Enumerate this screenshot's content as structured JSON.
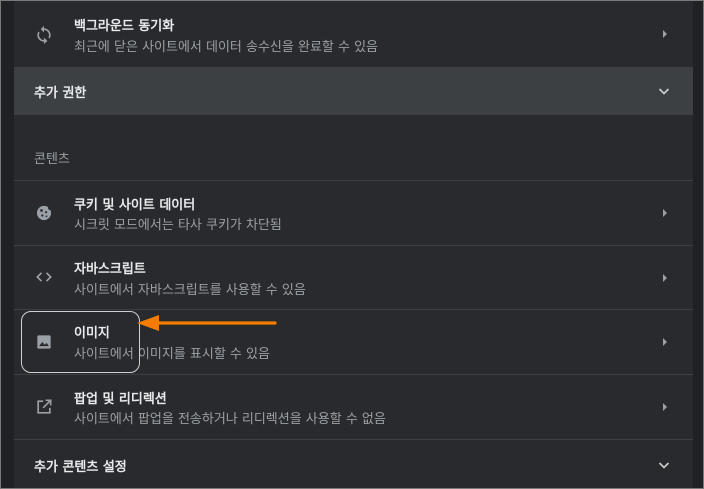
{
  "rows": {
    "background_sync": {
      "title": "백그라운드 동기화",
      "subtitle": "최근에 닫은 사이트에서 데이터 송수신을 완료할 수 있음",
      "icon": "sync-icon"
    },
    "additional_permissions": {
      "label": "추가 권한"
    },
    "content_section": {
      "label": "콘텐츠"
    },
    "cookies": {
      "title": "쿠키 및 사이트 데이터",
      "subtitle": "시크릿 모드에서는 타사 쿠키가 차단됨",
      "icon": "cookie-icon"
    },
    "javascript": {
      "title": "자바스크립트",
      "subtitle": "사이트에서 자바스크립트를 사용할 수 있음",
      "icon": "code-icon"
    },
    "images": {
      "title": "이미지",
      "subtitle": "사이트에서 이미지를 표시할 수 있음",
      "icon": "image-icon"
    },
    "popups": {
      "title": "팝업 및 리디렉션",
      "subtitle": "사이트에서 팝업을 전송하거나 리디렉션을 사용할 수 없음",
      "icon": "open-in-new-icon"
    },
    "additional_content": {
      "label": "추가 콘텐츠 설정"
    }
  },
  "annotation": {
    "color": "#f57c00"
  }
}
